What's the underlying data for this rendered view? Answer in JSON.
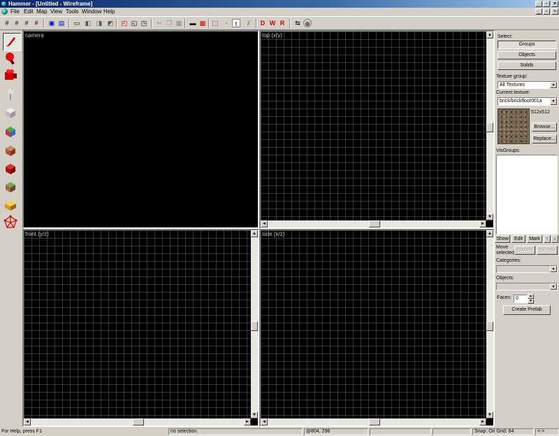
{
  "window": {
    "title": "Hammer - [Untitled - Wireframe]"
  },
  "menu": {
    "items": [
      "File",
      "Edit",
      "Map",
      "View",
      "Tools",
      "Window",
      "Help"
    ]
  },
  "viewports": {
    "camera": "camera",
    "top": "top (x/y)",
    "front": "front (y/z)",
    "side": "side (x/z)"
  },
  "panel": {
    "select_label": "Select:",
    "select_buttons": [
      "Groups",
      "Objects",
      "Solids"
    ],
    "texture_group_label": "Texture group:",
    "texture_group_value": "All Textures",
    "current_texture_label": "Current texture:",
    "current_texture_value": "brick/brickfloor001a",
    "texture_size": "512x512",
    "browse_label": "Browse...",
    "replace_label": "Replace...",
    "visgroups_label": "VisGroups:",
    "vis_buttons": [
      "Show",
      "Edit",
      "Mark"
    ],
    "move_selected_label": "Move selected",
    "toward_label": "toWorld",
    "toentity_label": "toEntity",
    "categories_label": "Categories:",
    "objects_label": "Objects:",
    "faces_label": "Faces:",
    "faces_value": "0",
    "create_prefab_label": "Create Prefab"
  },
  "status": {
    "help": "For Help, press F1",
    "selection": "no selection.",
    "coords": "@804, 296",
    "snap": "Snap: On Grid: 64",
    "zoom": "<->"
  },
  "colors": {
    "titlebar_start": "#0a246a",
    "titlebar_end": "#a6caf0",
    "chrome": "#d4d0c8",
    "viewport_bg": "#000000"
  },
  "icons": {
    "toolbar": [
      "grid-icon",
      "grid-icon",
      "grid-icon",
      "grid-icon",
      "group-icon",
      "ungroup-icon",
      "hide-icon",
      "cut-icon",
      "copy-icon",
      "paste-icon",
      "undo-icon",
      "redo-icon",
      "carve-icon",
      "map-check-icon",
      "run-map-icon"
    ],
    "tools": [
      "selection-tool-icon",
      "magnify-tool-icon",
      "camera-tool-icon",
      "entity-tool-icon",
      "block-tool-icon",
      "texture-application-icon",
      "apply-texture-icon",
      "decal-tool-icon",
      "overlay-tool-icon",
      "clipping-tool-icon",
      "vertex-tool-icon"
    ]
  }
}
